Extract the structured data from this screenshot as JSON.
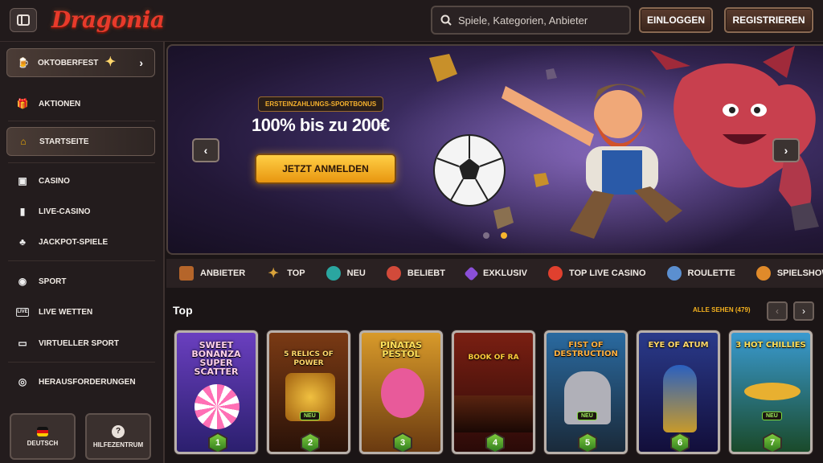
{
  "header": {
    "logo": "Dragonia",
    "search_placeholder": "Spiele, Kategorien, Anbieter",
    "login": "EINLOGGEN",
    "register": "REGISTRIEREN"
  },
  "sidebar": {
    "promo": "OKTOBERFEST",
    "items": [
      {
        "label": "AKTIONEN",
        "icon": "gift-icon"
      },
      {
        "label": "STARTSEITE",
        "icon": "home-icon",
        "active": true
      },
      {
        "label": "CASINO",
        "icon": "slot-machine-icon"
      },
      {
        "label": "LIVE-CASINO",
        "icon": "live-card-icon"
      },
      {
        "label": "JACKPOT-SPIELE",
        "icon": "clover-icon"
      },
      {
        "label": "SPORT",
        "icon": "ball-icon"
      },
      {
        "label": "LIVE WETTEN",
        "icon": "live-badge-icon"
      },
      {
        "label": "VIRTUELLER SPORT",
        "icon": "virtual-sport-icon"
      },
      {
        "label": "HERAUSFORDERUNGEN",
        "icon": "target-icon"
      }
    ],
    "language_button": "DEUTSCH",
    "help_button": "HILFEZENTRUM"
  },
  "banner": {
    "badge": "ERSTEINZAHLUNGS-SPORTBONUS",
    "title": "100% bis zu 200€",
    "cta": "JETZT ANMELDEN",
    "slide_count": 2,
    "active_slide": 2
  },
  "categories": [
    {
      "label": "ANBIETER",
      "icon": "chest-icon",
      "color": "#b5652a"
    },
    {
      "label": "TOP",
      "icon": "star-icon",
      "color": "#d9a23a"
    },
    {
      "label": "NEU",
      "icon": "gem-icon",
      "color": "#2aa6a0"
    },
    {
      "label": "BELIEBT",
      "icon": "rocket-icon",
      "color": "#d24a3a"
    },
    {
      "label": "EXKLUSIV",
      "icon": "crystal-icon",
      "color": "#8a4fd8"
    },
    {
      "label": "TOP LIVE CASINO",
      "icon": "mushroom-icon",
      "color": "#e0402e"
    },
    {
      "label": "ROULETTE",
      "icon": "roulette-icon",
      "color": "#5b8fd0"
    },
    {
      "label": "SPIELSHOWS",
      "icon": "show-wheel-icon",
      "color": "#e08a2a"
    }
  ],
  "top_section": {
    "title": "Top",
    "see_all": "ALLE SEHEN (479)"
  },
  "games": [
    {
      "title": "SWEET BONANZA SUPER SCATTER",
      "rank": "1",
      "new": "",
      "bg": "#6a3fbf",
      "bg2": "#2b1f6e"
    },
    {
      "title": "5 RELICS OF POWER",
      "rank": "2",
      "new": "NEU",
      "bg": "#7a3a14",
      "bg2": "#2a1208"
    },
    {
      "title": "PIÑATAS PESTOL",
      "rank": "3",
      "new": "",
      "bg": "#d89a2a",
      "bg2": "#6a3a10"
    },
    {
      "title": "BOOK OF RA",
      "rank": "4",
      "new": "",
      "bg": "#7a1f12",
      "bg2": "#2a0a08"
    },
    {
      "title": "FIST OF DESTRUCTION",
      "rank": "5",
      "new": "NEU",
      "bg": "#2a6aa0",
      "bg2": "#1a2a3a"
    },
    {
      "title": "EYE OF ATUM",
      "rank": "6",
      "new": "",
      "bg": "#2a3a8a",
      "bg2": "#120e3a"
    },
    {
      "title": "3 HOT CHILLIES",
      "rank": "7",
      "new": "NEU",
      "bg": "#3a9ad0",
      "bg2": "#1a4a2a"
    }
  ]
}
